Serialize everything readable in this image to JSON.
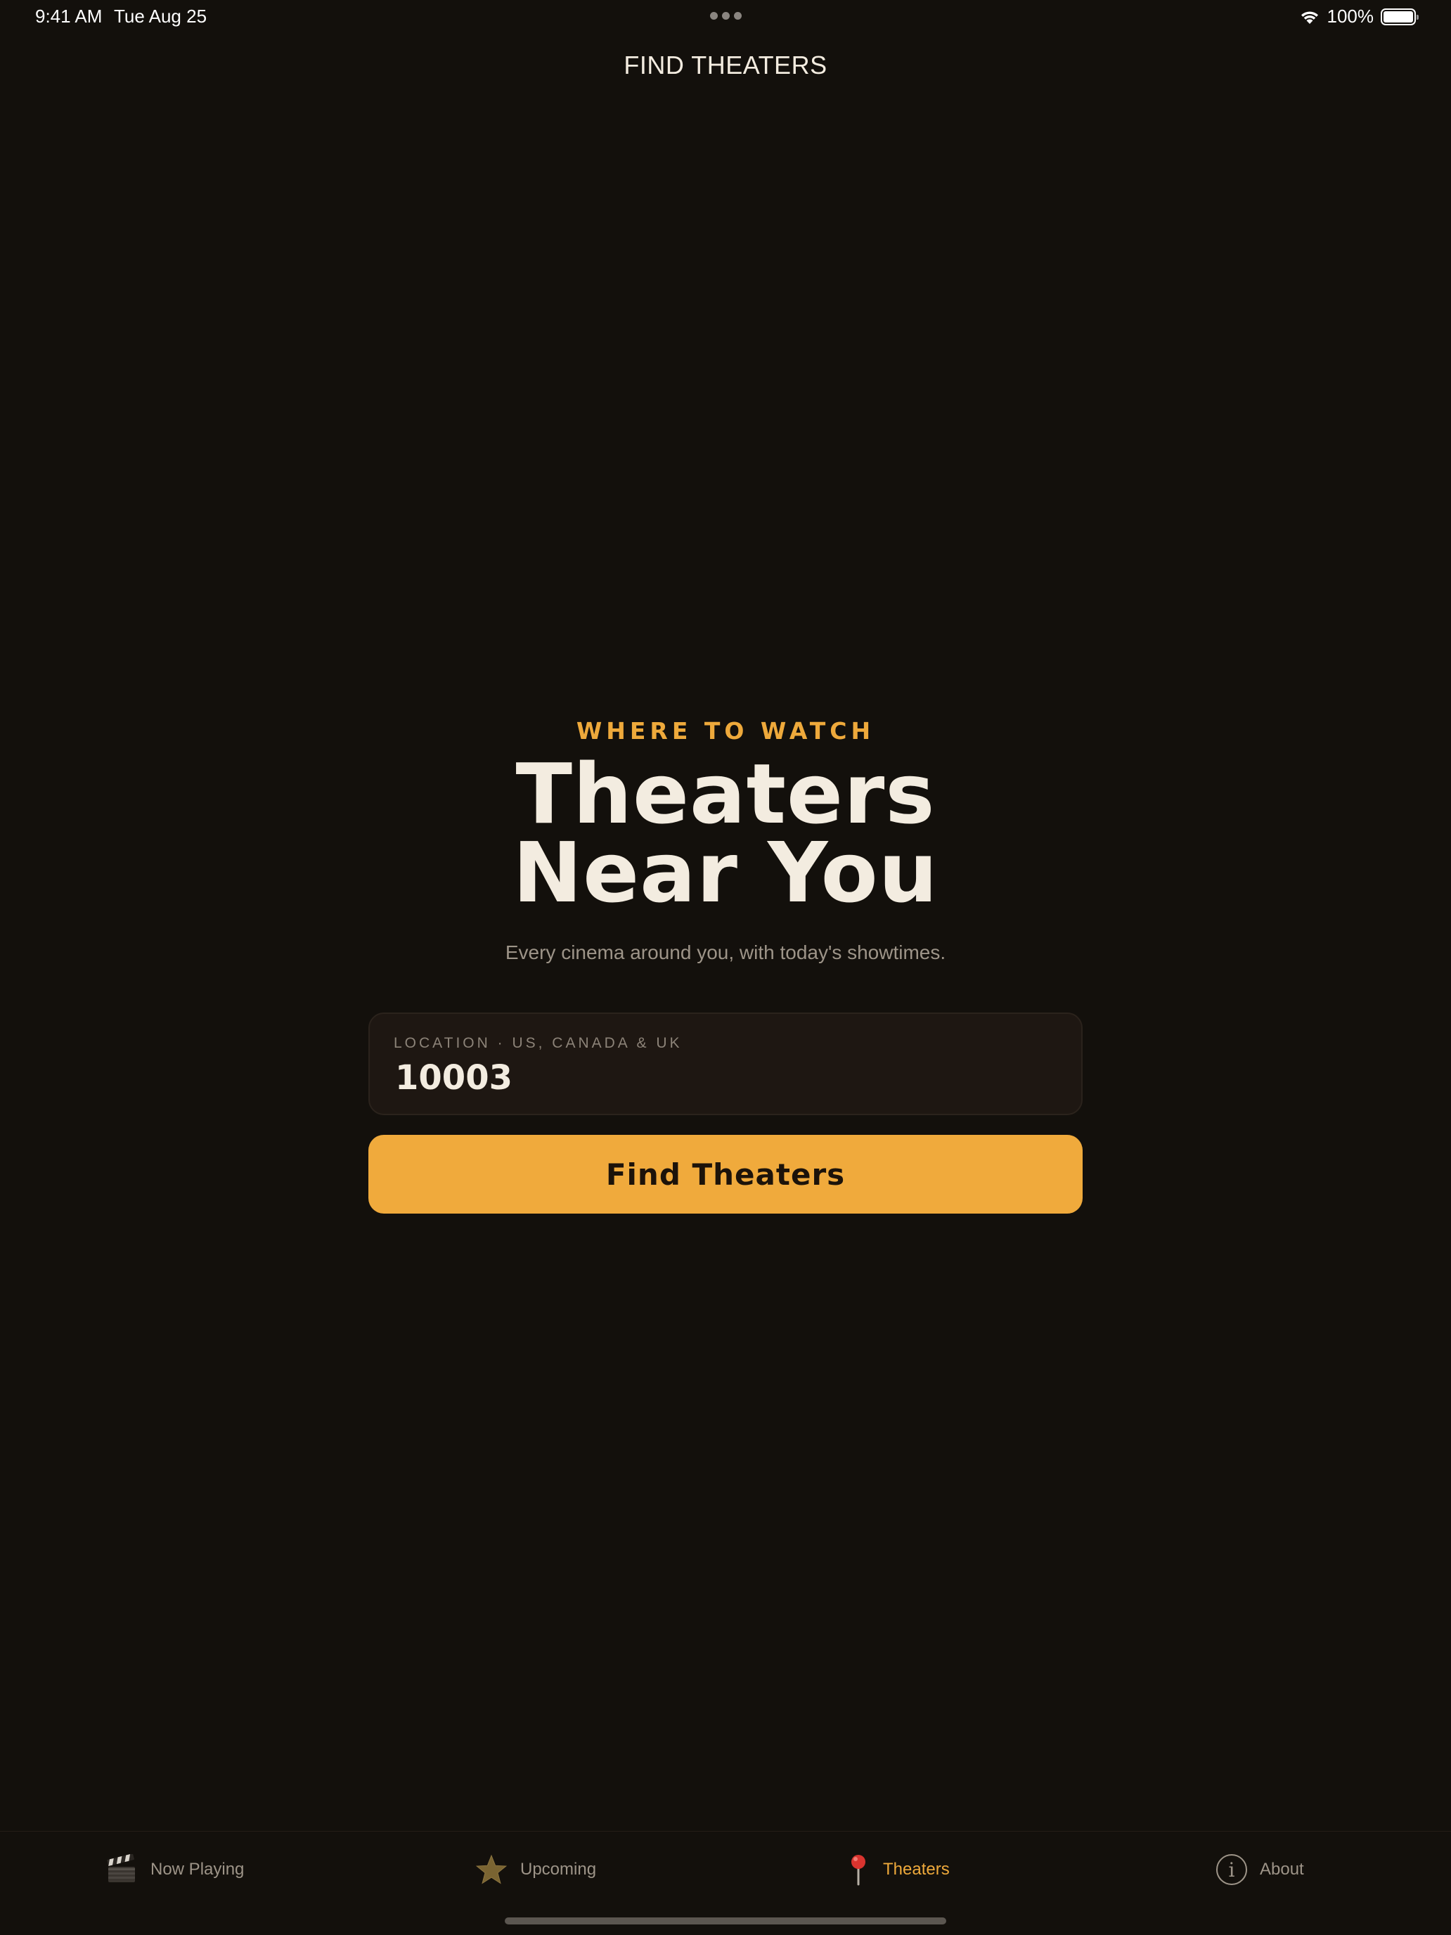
{
  "status_bar": {
    "time": "9:41 AM",
    "date": "Tue Aug 25",
    "battery": "100%"
  },
  "nav": {
    "title": "FIND THEATERS"
  },
  "hero": {
    "eyebrow": "WHERE TO WATCH",
    "headline": "Theaters Near You",
    "subtitle": "Every cinema around you, with today's showtimes."
  },
  "location": {
    "label": "LOCATION · US, CANADA & UK",
    "value": "10003"
  },
  "actions": {
    "find_label": "Find Theaters"
  },
  "tabs": [
    {
      "label": "Now Playing",
      "icon": "clapperboard-icon"
    },
    {
      "label": "Upcoming",
      "icon": "star-icon"
    },
    {
      "label": "Theaters",
      "icon": "pushpin-icon",
      "active": true
    },
    {
      "label": "About",
      "icon": "info-icon"
    }
  ],
  "colors": {
    "background": "#13100c",
    "accent": "#f0aa3c",
    "text_primary": "#f3ece0",
    "text_secondary": "#9d9488"
  }
}
